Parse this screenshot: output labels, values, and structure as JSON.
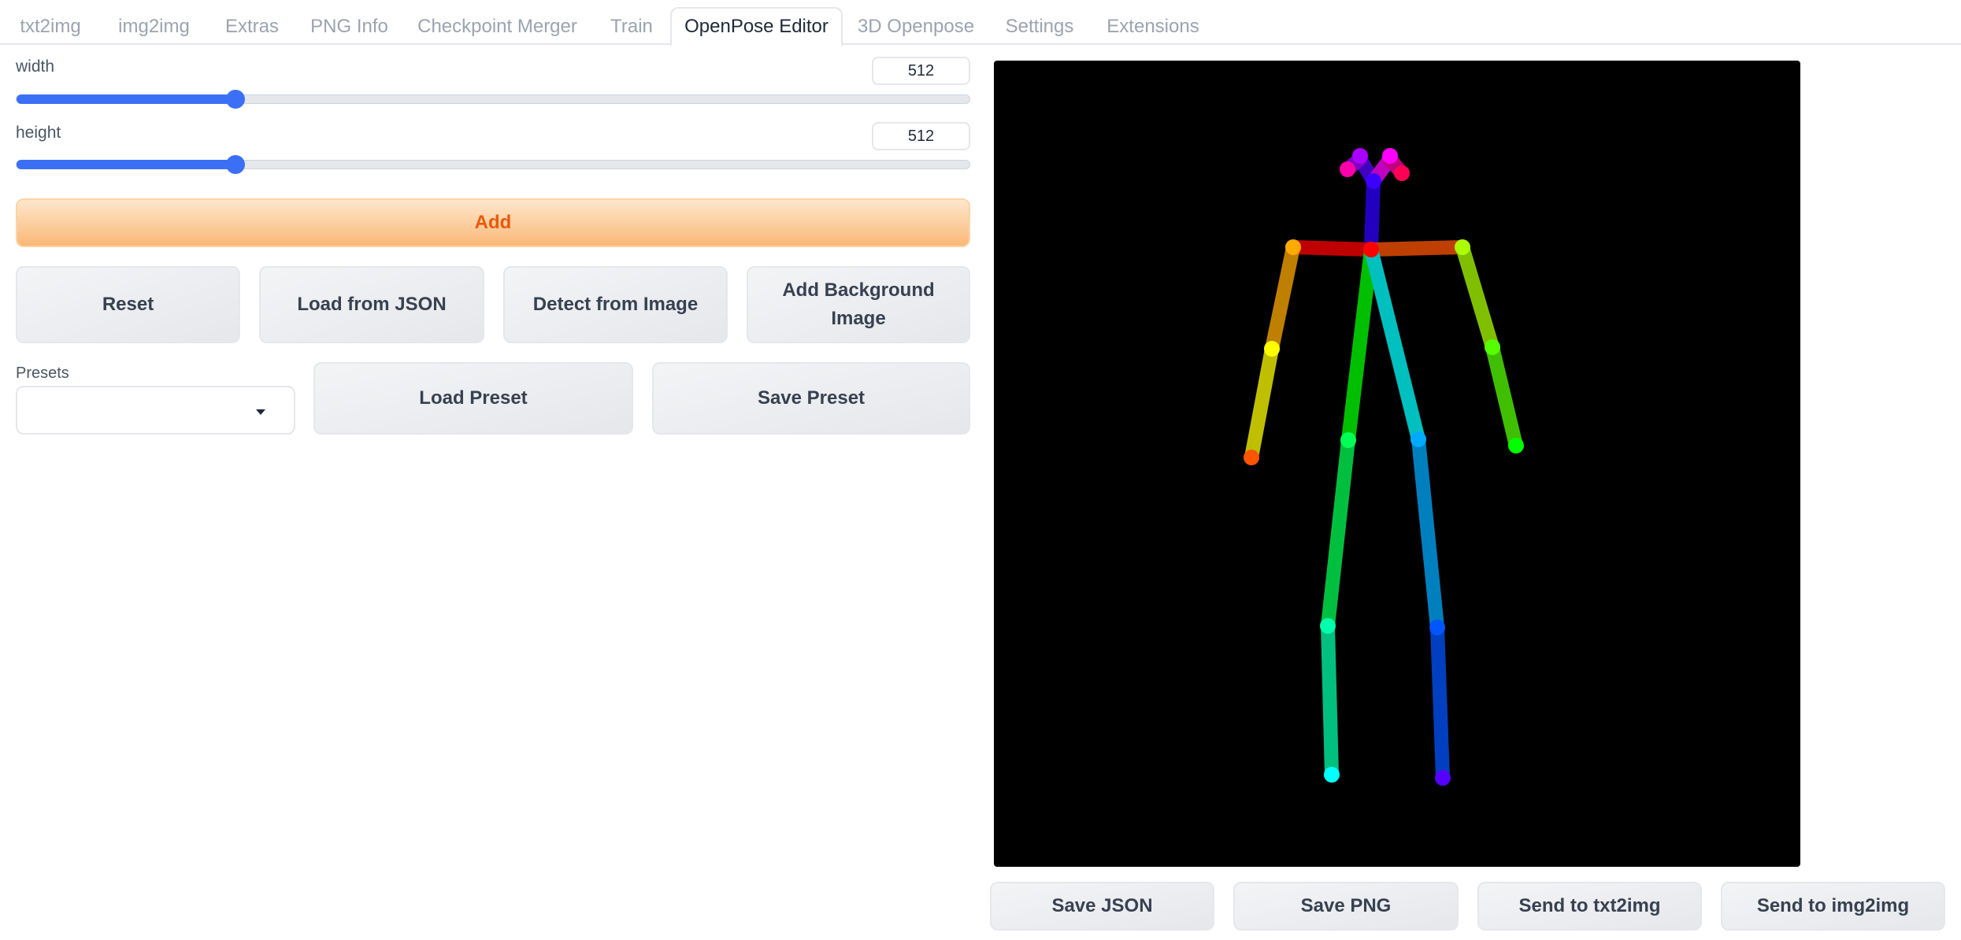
{
  "tabs": [
    {
      "label": "txt2img",
      "active": false
    },
    {
      "label": "img2img",
      "active": false
    },
    {
      "label": "Extras",
      "active": false
    },
    {
      "label": "PNG Info",
      "active": false
    },
    {
      "label": "Checkpoint Merger",
      "active": false
    },
    {
      "label": "Train",
      "active": false
    },
    {
      "label": "OpenPose Editor",
      "active": true
    },
    {
      "label": "3D Openpose",
      "active": false
    },
    {
      "label": "Settings",
      "active": false
    },
    {
      "label": "Extensions",
      "active": false
    }
  ],
  "width_control": {
    "label": "width",
    "value": "512",
    "slider_fraction": 0.23
  },
  "height_control": {
    "label": "height",
    "value": "512",
    "slider_fraction": 0.23
  },
  "buttons": {
    "add": "Add",
    "reset": "Reset",
    "load_json": "Load from JSON",
    "detect": "Detect from Image",
    "add_background": "Add Background Image",
    "load_preset": "Load Preset",
    "save_preset": "Save Preset",
    "save_json": "Save JSON",
    "save_png": "Save PNG",
    "send_txt2img": "Send to txt2img",
    "send_img2img": "Send to img2img"
  },
  "presets": {
    "label": "Presets",
    "value": ""
  },
  "colors": {
    "accent_blue": "#3b6ff5",
    "primary_button_text": "#ea580c",
    "canvas_background": "#000000"
  }
}
